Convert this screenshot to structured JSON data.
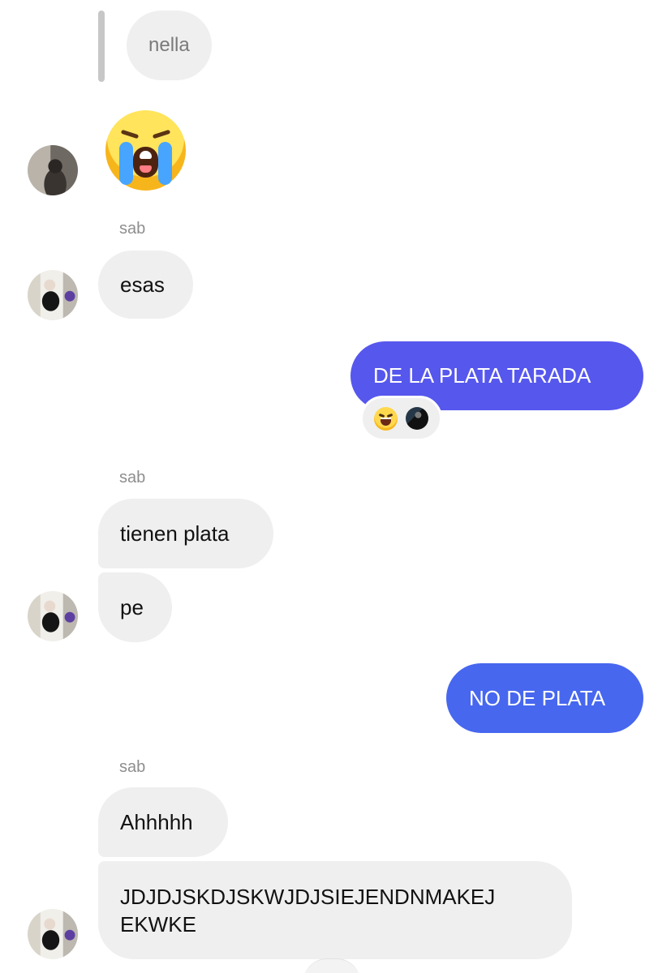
{
  "replied_message": {
    "text": "nella"
  },
  "messages": [
    {
      "sender": "",
      "type": "emoji",
      "emoji": "loudly-crying-face"
    },
    {
      "sender": "sab",
      "text": "esas"
    },
    {
      "sender": "me",
      "text": "DE LA PLATA TARADA",
      "bubble_color": "#5657ed",
      "reactions": [
        "face-with-tears-of-joy",
        "avatar"
      ]
    },
    {
      "sender": "sab",
      "text": "tienen plata"
    },
    {
      "sender": "sab",
      "text": "pe"
    },
    {
      "sender": "me",
      "text": "NO DE PLATA",
      "bubble_color": "#4767ef"
    },
    {
      "sender": "sab",
      "text": "Ahhhhh"
    },
    {
      "sender": "sab",
      "text_line_1": "JDJDJSKDJSKWJDJSIEJENDNMAKEJ",
      "text_line_2": "EKWKE"
    }
  ],
  "colors": {
    "incoming_bubble": "#efefef",
    "outgoing_purple": "#5657ed",
    "outgoing_blue": "#4767ef",
    "sender_label": "#8e8e8e"
  }
}
